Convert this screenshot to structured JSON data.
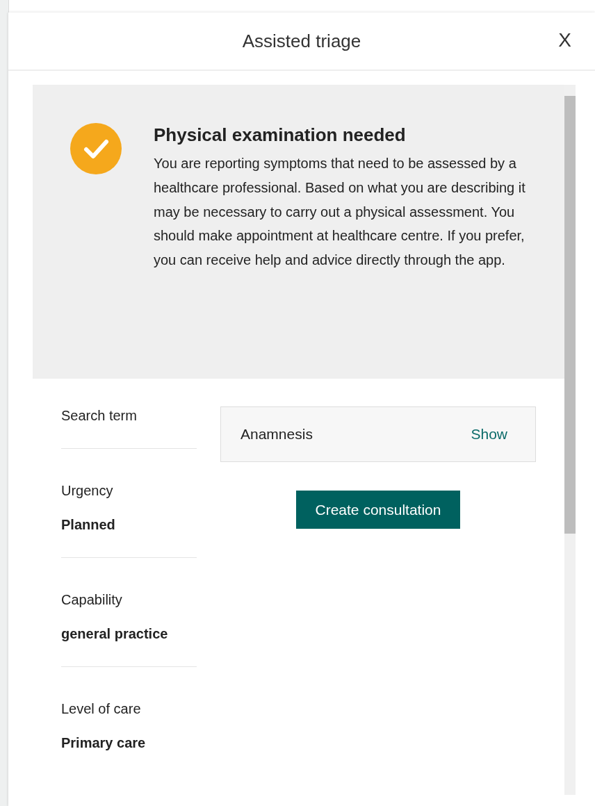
{
  "dialog": {
    "title": "Assisted triage",
    "close": "X"
  },
  "result": {
    "title": "Physical examination needed",
    "text": "You are reporting symptoms that need to be assessed by a healthcare professional. Based on what you are describing it may be necessary to carry out a physical assessment. You should make appointment at healthcare centre. If you prefer, you can receive help and advice directly through the app."
  },
  "details": [
    {
      "label": "Search term"
    },
    {
      "label": "Urgency",
      "value": "Planned"
    },
    {
      "label": "Capability",
      "value": "general practice"
    },
    {
      "label": "Level of care",
      "value": "Primary care"
    }
  ],
  "anamnesis": {
    "label": "Anamnesis",
    "action": "Show"
  },
  "primary_button": "Create consultation"
}
